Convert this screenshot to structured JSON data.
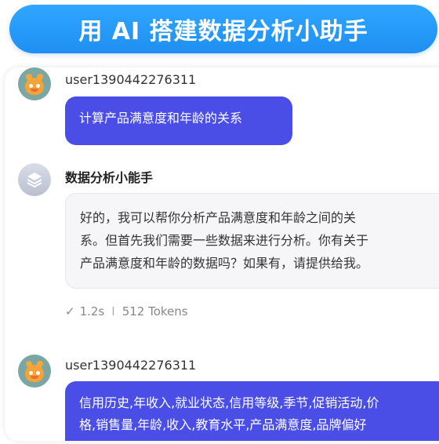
{
  "banner": {
    "title": "用 AI 搭建数据分析小助手"
  },
  "chat": {
    "messages": [
      {
        "role": "user",
        "name": "user1390442276311",
        "text": "计算产品满意度和年龄的关系"
      },
      {
        "role": "assistant",
        "name": "数据分析小能手",
        "lines": [
          "好的，我可以帮你分析产品满意度和年龄之间的关",
          "系。但首先我们需要一些数据来进行分析。你有关于",
          "产品满意度和年龄的数据吗？如果有，请提供给我。"
        ],
        "meta": {
          "check_icon": "check-icon",
          "time": "1.2s",
          "separator": "I",
          "tokens": "512 Tokens"
        }
      },
      {
        "role": "user",
        "name": "user1390442276311",
        "lines": [
          "信用历史,年收入,就业状态,信用等级,季节,促销活动,价",
          "格,销售量,年龄,收入,教育水平,产品满意度,品牌偏好"
        ]
      }
    ]
  },
  "colors": {
    "banner": "#1f8ff2",
    "user_bubble": "#4b4ee6",
    "bot_bubble": "#f6f6f8"
  }
}
